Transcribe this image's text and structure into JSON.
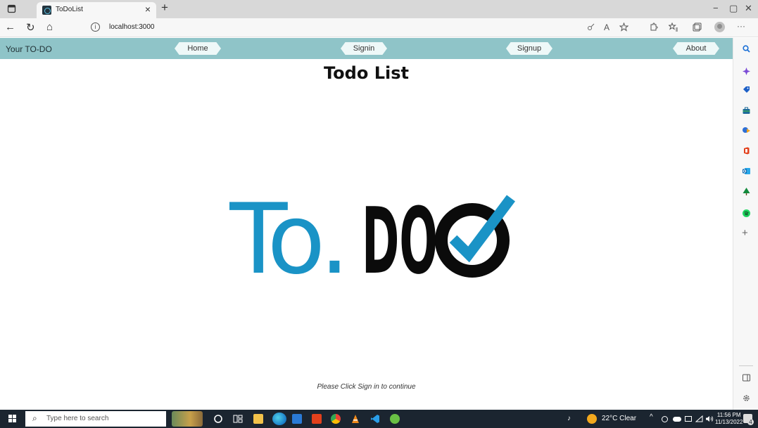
{
  "browser": {
    "tab_title": "ToDoList",
    "tab_close": "×",
    "new_tab": "+",
    "url": "localhost:3000",
    "window_controls": {
      "minimize": "−",
      "restore": "▢",
      "close": "✕"
    },
    "nav": {
      "back": "←",
      "refresh": "↻",
      "home": "⌂",
      "more": "···"
    }
  },
  "navbar": {
    "brand": "Your TO-DO",
    "links": [
      "Home",
      "Signin",
      "Signup",
      "About"
    ]
  },
  "page": {
    "heading": "Todo List",
    "logo_left": "To.",
    "logo_right": "DO",
    "footer_note": "Please Click Sign in to continue"
  },
  "sidebar": {
    "icons": [
      "search-icon",
      "copilot-icon",
      "tag-icon",
      "briefcase-icon",
      "games-icon",
      "office-icon",
      "outlook-icon",
      "tree-icon",
      "spotify-icon",
      "add-icon",
      "sidebar-toggle-icon",
      "settings-icon"
    ],
    "add": "+"
  },
  "taskbar": {
    "search_placeholder": "Type here to search",
    "weather": "22°C  Clear",
    "time": "11:56 PM",
    "date": "11/13/2022",
    "notification_count": "4"
  },
  "colors": {
    "navbar": "#8fc4c8",
    "logo_blue": "#1a93c6",
    "logo_black": "#0b0b0b"
  }
}
